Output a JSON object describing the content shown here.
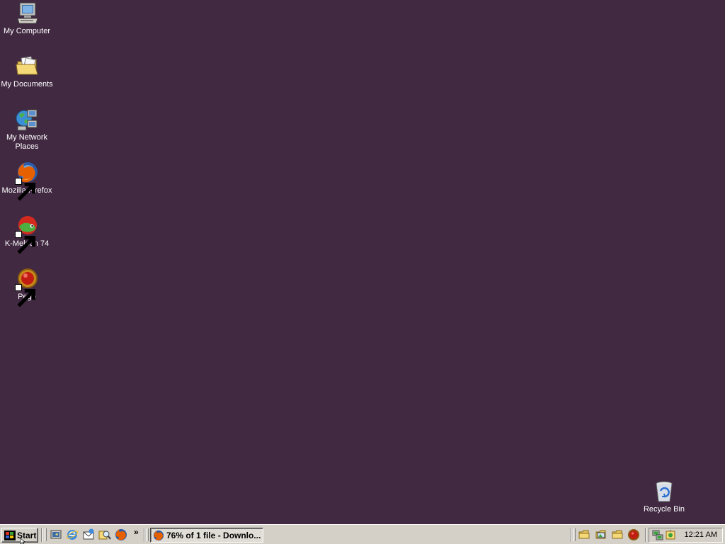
{
  "desktop": {
    "background_color": "#412942",
    "icons": [
      {
        "label": "My Computer",
        "icon": "computer-icon"
      },
      {
        "label": "My Documents",
        "icon": "documents-folder-icon"
      },
      {
        "label": "My Network Places",
        "icon": "network-places-icon"
      },
      {
        "label": "Mozilla Firefox",
        "icon": "firefox-icon",
        "shortcut": true
      },
      {
        "label": "K-Meleon 74",
        "icon": "k-meleon-icon",
        "shortcut": true
      },
      {
        "label": "Pego",
        "icon": "pego-icon",
        "shortcut": true
      },
      {
        "label": "Recycle Bin",
        "icon": "recycle-bin-icon"
      }
    ]
  },
  "taskbar": {
    "start_label": "Start",
    "quick_launch": [
      "show-desktop-icon",
      "internet-explorer-icon",
      "outlook-express-icon",
      "search-icon",
      "firefox-icon"
    ],
    "chevron": "»",
    "task_button": {
      "label": "76% of 1 file - Downlo...",
      "icon": "firefox-icon"
    },
    "toolbar_icons": [
      "folder-icon",
      "image-folder-icon",
      "folder-icon",
      "pego-icon"
    ],
    "tray_icons": [
      "network-icon",
      "security-icon"
    ],
    "clock": "12:21 AM"
  }
}
